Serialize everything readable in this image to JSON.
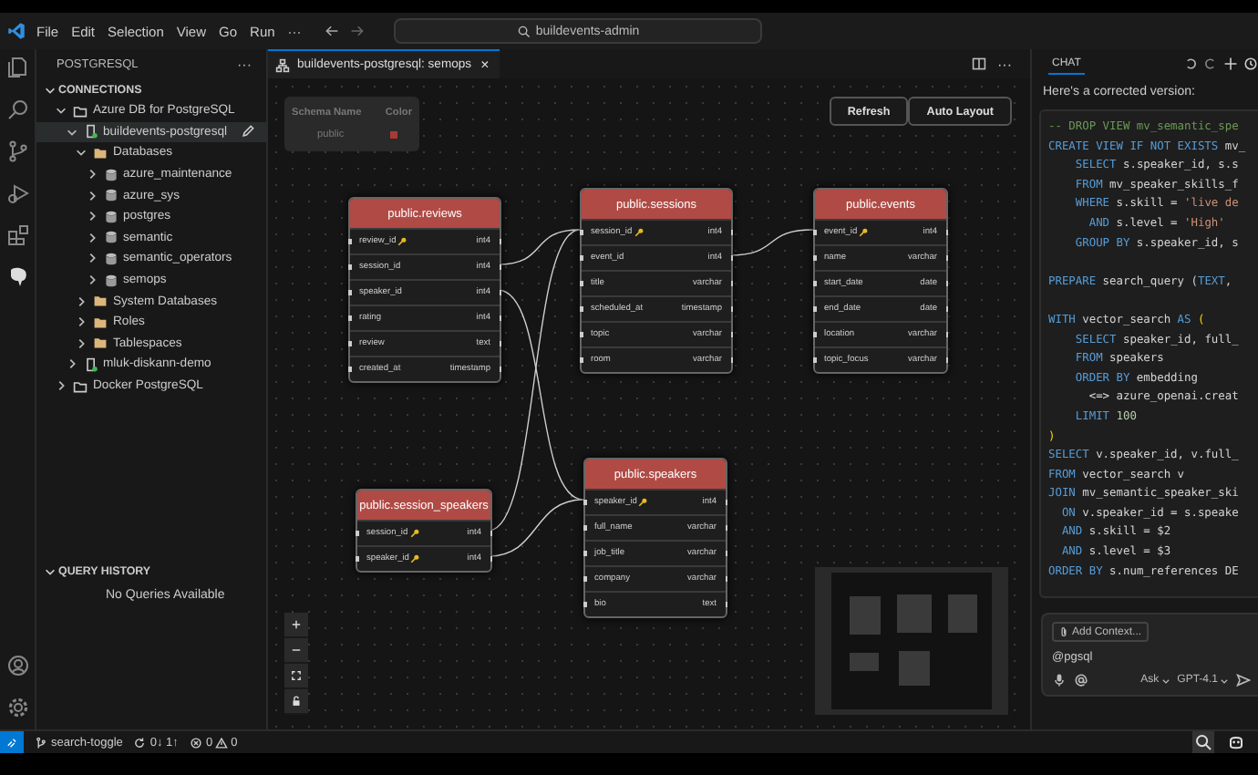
{
  "menu": [
    "File",
    "Edit",
    "Selection",
    "View",
    "Go",
    "Run",
    "···"
  ],
  "command_center": {
    "text": "buildevents-admin"
  },
  "sidebar": {
    "title": "POSTGRESQL",
    "more": "···",
    "sections": [
      {
        "title": "CONNECTIONS",
        "expanded": true,
        "tree": [
          {
            "label": "Azure DB for PostgreSQL",
            "kind": "group",
            "expanded": true,
            "selected": false,
            "children": [
              {
                "label": "buildevents-postgresql",
                "kind": "server",
                "expanded": true,
                "selected": true,
                "children": [
                  {
                    "label": "Databases",
                    "kind": "folder",
                    "expanded": true,
                    "selected": false,
                    "children": [
                      {
                        "label": "azure_maintenance",
                        "kind": "database",
                        "expanded": false,
                        "selected": false
                      },
                      {
                        "label": "azure_sys",
                        "kind": "database",
                        "expanded": false,
                        "selected": false
                      },
                      {
                        "label": "postgres",
                        "kind": "database",
                        "expanded": false,
                        "selected": false
                      },
                      {
                        "label": "semantic",
                        "kind": "database",
                        "expanded": false,
                        "selected": false
                      },
                      {
                        "label": "semantic_operators",
                        "kind": "database",
                        "expanded": false,
                        "selected": false
                      },
                      {
                        "label": "semops",
                        "kind": "database",
                        "expanded": false,
                        "selected": false
                      }
                    ]
                  },
                  {
                    "label": "System Databases",
                    "kind": "folder",
                    "expanded": false,
                    "selected": false
                  },
                  {
                    "label": "Roles",
                    "kind": "folder",
                    "expanded": false,
                    "selected": false
                  },
                  {
                    "label": "Tablespaces",
                    "kind": "folder",
                    "expanded": false,
                    "selected": false
                  }
                ]
              },
              {
                "label": "mluk-diskann-demo",
                "kind": "server",
                "expanded": false,
                "selected": false
              }
            ]
          },
          {
            "label": "Docker PostgreSQL",
            "kind": "group",
            "expanded": false,
            "selected": false
          }
        ]
      },
      {
        "title": "QUERY HISTORY",
        "expanded": true,
        "empty_text": "No Queries Available"
      }
    ]
  },
  "editor_tab": {
    "label": "buildevents-postgresql: semops",
    "close": "×"
  },
  "tab_more": "···",
  "legend": {
    "columns": [
      "Schema Name",
      "Color"
    ],
    "rows": [
      {
        "schema": "public",
        "color": "#a83a36"
      }
    ]
  },
  "toolbar_buttons": [
    "Refresh",
    "Auto Layout"
  ],
  "tables": [
    {
      "title": "public.reviews",
      "columns": [
        {
          "name": "review_id",
          "type": "int4",
          "primary_key": true
        },
        {
          "name": "session_id",
          "type": "int4",
          "primary_key": false
        },
        {
          "name": "speaker_id",
          "type": "int4",
          "primary_key": false
        },
        {
          "name": "rating",
          "type": "int4",
          "primary_key": false
        },
        {
          "name": "review",
          "type": "text",
          "primary_key": false
        },
        {
          "name": "created_at",
          "type": "timestamp",
          "primary_key": false
        }
      ]
    },
    {
      "title": "public.sessions",
      "columns": [
        {
          "name": "session_id",
          "type": "int4",
          "primary_key": true
        },
        {
          "name": "event_id",
          "type": "int4",
          "primary_key": false
        },
        {
          "name": "title",
          "type": "varchar",
          "primary_key": false
        },
        {
          "name": "scheduled_at",
          "type": "timestamp",
          "primary_key": false
        },
        {
          "name": "topic",
          "type": "varchar",
          "primary_key": false
        },
        {
          "name": "room",
          "type": "varchar",
          "primary_key": false
        }
      ]
    },
    {
      "title": "public.events",
      "columns": [
        {
          "name": "event_id",
          "type": "int4",
          "primary_key": true
        },
        {
          "name": "name",
          "type": "varchar",
          "primary_key": false
        },
        {
          "name": "start_date",
          "type": "date",
          "primary_key": false
        },
        {
          "name": "end_date",
          "type": "date",
          "primary_key": false
        },
        {
          "name": "location",
          "type": "varchar",
          "primary_key": false
        },
        {
          "name": "topic_focus",
          "type": "varchar",
          "primary_key": false
        }
      ]
    },
    {
      "title": "public.session_speakers",
      "columns": [
        {
          "name": "session_id",
          "type": "int4",
          "primary_key": true
        },
        {
          "name": "speaker_id",
          "type": "int4",
          "primary_key": true
        }
      ]
    },
    {
      "title": "public.speakers",
      "columns": [
        {
          "name": "speaker_id",
          "type": "int4",
          "primary_key": true
        },
        {
          "name": "full_name",
          "type": "varchar",
          "primary_key": false
        },
        {
          "name": "job_title",
          "type": "varchar",
          "primary_key": false
        },
        {
          "name": "company",
          "type": "varchar",
          "primary_key": false
        },
        {
          "name": "bio",
          "type": "text",
          "primary_key": false
        }
      ]
    }
  ],
  "chat": {
    "title": "CHAT",
    "intro": "Here's a corrected version:",
    "code_blocks": [
      [
        [
          {
            "text": "-- DROP VIEW mv_semantic_spe",
            "kind": "comment"
          }
        ],
        [
          {
            "text": "CREATE VIEW IF NOT EXISTS",
            "kind": "keyword"
          },
          {
            "text": " mv_",
            "kind": "plain"
          }
        ],
        [
          {
            "text": "    SELECT",
            "kind": "keyword"
          },
          {
            "text": " s.speaker_id, s.s",
            "kind": "plain"
          }
        ],
        [
          {
            "text": "    FROM",
            "kind": "keyword"
          },
          {
            "text": " mv_speaker_skills_f",
            "kind": "plain"
          }
        ],
        [
          {
            "text": "    WHERE",
            "kind": "keyword"
          },
          {
            "text": " s.skill = ",
            "kind": "plain"
          },
          {
            "text": "'live de",
            "kind": "string"
          }
        ],
        [
          {
            "text": "      AND",
            "kind": "keyword"
          },
          {
            "text": " s.level = ",
            "kind": "plain"
          },
          {
            "text": "'High'",
            "kind": "string"
          }
        ],
        [
          {
            "text": "    GROUP BY",
            "kind": "keyword"
          },
          {
            "text": " s.speaker_id, s",
            "kind": "plain"
          }
        ]
      ],
      [
        [
          {
            "text": "PREPARE",
            "kind": "keyword"
          },
          {
            "text": " search_query (",
            "kind": "plain"
          },
          {
            "text": "TEXT",
            "kind": "keyword"
          },
          {
            "text": ",",
            "kind": "plain"
          }
        ]
      ],
      [
        [
          {
            "text": "WITH",
            "kind": "keyword"
          },
          {
            "text": " vector_search ",
            "kind": "plain"
          },
          {
            "text": "AS",
            "kind": "keyword"
          },
          {
            "text": " (",
            "kind": "bracket"
          }
        ],
        [
          {
            "text": "    SELECT",
            "kind": "keyword"
          },
          {
            "text": " speaker_id, full_",
            "kind": "plain"
          }
        ],
        [
          {
            "text": "    FROM",
            "kind": "keyword"
          },
          {
            "text": " speakers",
            "kind": "plain"
          }
        ],
        [
          {
            "text": "    ORDER BY",
            "kind": "keyword"
          },
          {
            "text": " embedding",
            "kind": "plain"
          }
        ],
        [
          {
            "text": "      <=> azure_openai.creat",
            "kind": "plain"
          }
        ],
        [
          {
            "text": "    LIMIT",
            "kind": "keyword"
          },
          {
            "text": " 100",
            "kind": "number"
          }
        ],
        [
          {
            "text": ")",
            "kind": "bracket"
          }
        ],
        [
          {
            "text": "SELECT",
            "kind": "keyword"
          },
          {
            "text": " v.speaker_id, v.full_",
            "kind": "plain"
          }
        ],
        [
          {
            "text": "FROM",
            "kind": "keyword"
          },
          {
            "text": " vector_search v",
            "kind": "plain"
          }
        ],
        [
          {
            "text": "JOIN",
            "kind": "keyword"
          },
          {
            "text": " mv_semantic_speaker_ski",
            "kind": "plain"
          }
        ],
        [
          {
            "text": "  ON",
            "kind": "keyword"
          },
          {
            "text": " v.speaker_id = s.speake",
            "kind": "plain"
          }
        ],
        [
          {
            "text": "  AND",
            "kind": "keyword"
          },
          {
            "text": " s.skill = $2",
            "kind": "plain"
          }
        ],
        [
          {
            "text": "  AND",
            "kind": "keyword"
          },
          {
            "text": " s.level = $3",
            "kind": "plain"
          }
        ],
        [
          {
            "text": "ORDER BY",
            "kind": "keyword"
          },
          {
            "text": " s.num_references DE",
            "kind": "plain"
          }
        ]
      ]
    ],
    "input": {
      "context_button": "Add Context...",
      "value": "@pgsql",
      "mode": "Ask",
      "model": "GPT-4.1"
    }
  },
  "status_bar": {
    "branch": "search-toggle",
    "sync": "0↓ 1↑",
    "errors": "0",
    "warnings": "0"
  }
}
